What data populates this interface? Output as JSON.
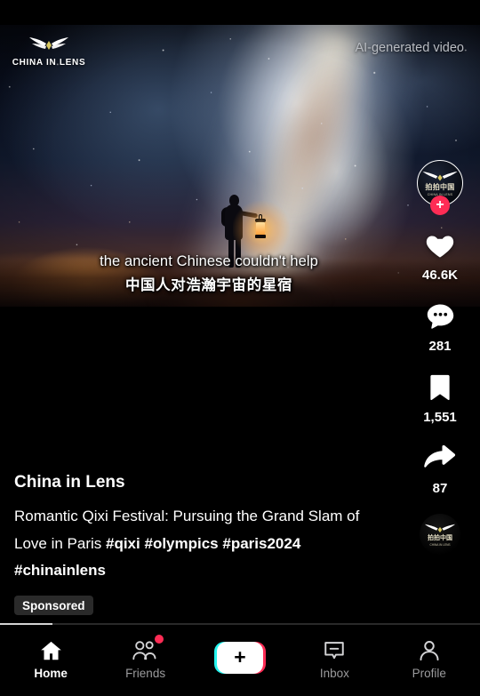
{
  "video": {
    "brand_logo_text": "CHINA IN LENS",
    "ai_label": "AI-generated video",
    "subtitle_en": "the ancient Chinese couldn't help",
    "subtitle_zh": "中国人对浩瀚宇宙的星宿",
    "scene_description": "silhouette of a person holding a lantern under the Milky Way galaxy"
  },
  "rail": {
    "avatar_name": "china-in-lens-avatar",
    "avatar_cn_text": "拍拍中国",
    "avatar_en_text": "CHINA IN LENS",
    "follow_label": "+",
    "like_count": "46.6K",
    "comment_count": "281",
    "bookmark_count": "1,551",
    "share_count": "87",
    "music_disc_cn": "拍拍中国",
    "music_disc_en": "CHINA IN LENS"
  },
  "caption": {
    "author": "China in Lens",
    "text_line1": "Romantic Qixi Festival: Pursuing the",
    "text_line2": "Grand Slam of Love in Paris ",
    "hashtag1": "#qixi",
    "hashtag2": "#olympics",
    "hashtag3": "#paris2024",
    "hashtag4": "#chinainlens",
    "sponsored_label": "Sponsored"
  },
  "nav": {
    "home": "Home",
    "friends": "Friends",
    "create": "+",
    "inbox": "Inbox",
    "profile": "Profile"
  },
  "colors": {
    "accent_pink": "#fe2c55",
    "accent_cyan": "#25f4ee",
    "background": "#000000",
    "inactive_text": "#9b9b9d"
  }
}
